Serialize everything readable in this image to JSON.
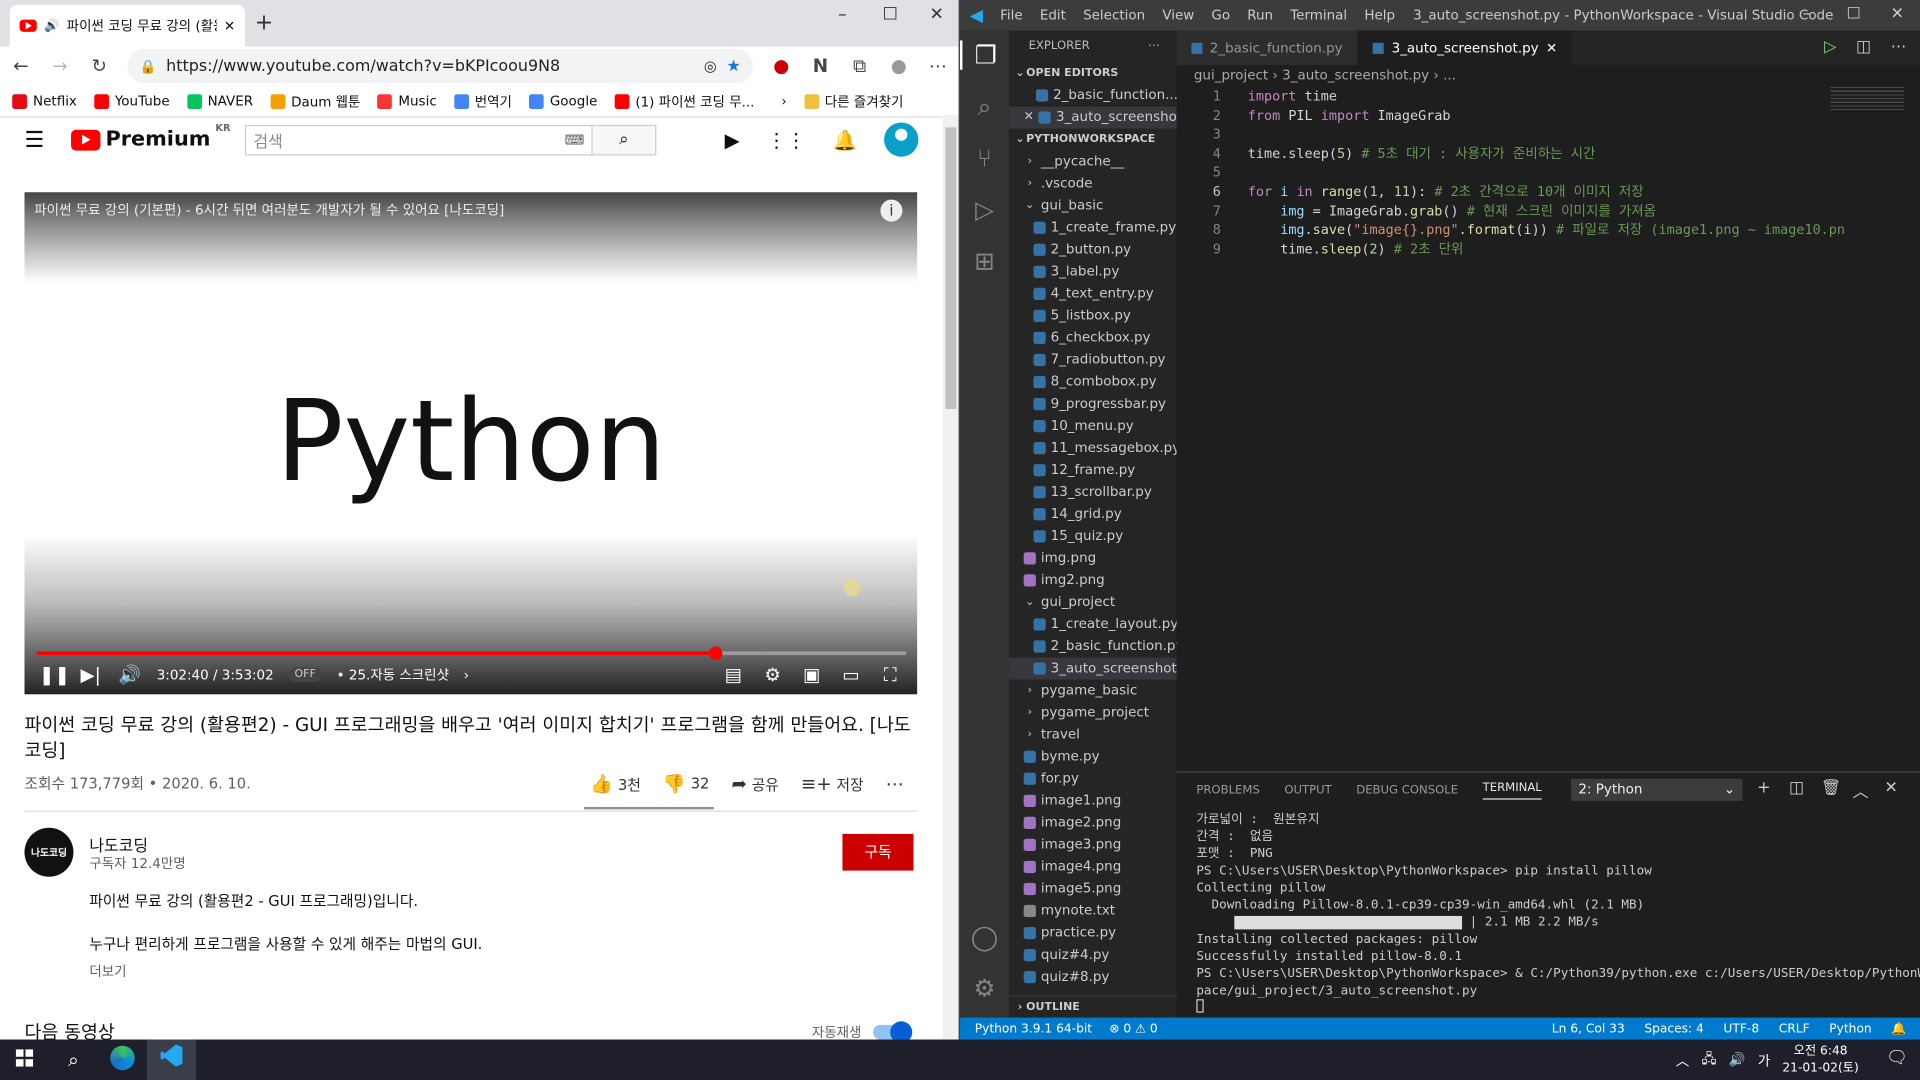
{
  "browser": {
    "tab_title": "파이썬 코딩 무료 강의 (활용",
    "url": "https://www.youtube.com/watch?v=bKPIcoou9N8",
    "bookmarks": [
      {
        "label": "Netflix",
        "color": "#e50914"
      },
      {
        "label": "YouTube",
        "color": "#ff0000"
      },
      {
        "label": "NAVER",
        "color": "#03c75a"
      },
      {
        "label": "Daum 웹툰",
        "color": "#f4a100"
      },
      {
        "label": "Music",
        "color": "#ff3333"
      },
      {
        "label": "번역기",
        "color": "#4285f4"
      },
      {
        "label": "Google",
        "color": "#4285f4"
      },
      {
        "label": "(1) 파이썬 코딩 무...",
        "color": "#ff0000"
      }
    ],
    "other_bookmarks": "다른 즐겨찾기"
  },
  "youtube": {
    "logo": "Premium",
    "region": "KR",
    "search_placeholder": "검색",
    "player_title": "파이썬 무료 강의 (기본편) - 6시간 뒤면 여러분도 개발자가 될 수 있어요 [나도코딩]",
    "player_word": "Python",
    "time": "3:02:40 / 3:53:02",
    "progress": 0.78,
    "autoplay_off": "OFF",
    "chapter": "• 25.자동 스크린샷",
    "video_title": "파이썬 코딩 무료 강의 (활용편2) - GUI 프로그래밍을 배우고 '여러 이미지 합치기' 프로그램을 함께 만들어요. [나도코딩]",
    "meta": "조회수 173,779회 • 2020. 6. 10.",
    "likes": "3천",
    "dislikes": "32",
    "share": "공유",
    "save": "저장",
    "channel": "나도코딩",
    "channel_avatar": "나도코딩",
    "subscribers": "구독자 12.4만명",
    "subscribe": "구독",
    "desc1": "파이썬 무료 강의 (활용편2 - GUI 프로그래밍)입니다.",
    "desc2": "누구나 편리하게 프로그램을 사용할 수 있게 해주는 마법의 GUI.",
    "more": "더보기",
    "next": "다음 동영상",
    "autoplay": "자동재생"
  },
  "vscode": {
    "menu": [
      "File",
      "Edit",
      "Selection",
      "View",
      "Go",
      "Run",
      "Terminal",
      "Help"
    ],
    "title": "3_auto_screenshot.py - PythonWorkspace - Visual Studio Code",
    "explorer": "EXPLORER",
    "open_editors": "OPEN EDITORS",
    "open_files": [
      "2_basic_function....",
      "3_auto_screensho..."
    ],
    "workspace": "PYTHONWORKSPACE",
    "tree": [
      {
        "label": "__pycache__",
        "t": "dir",
        "d": 1
      },
      {
        "label": ".vscode",
        "t": "dir",
        "d": 1
      },
      {
        "label": "gui_basic",
        "t": "open",
        "d": 1
      },
      {
        "label": "1_create_frame.py",
        "t": "py",
        "d": 2
      },
      {
        "label": "2_button.py",
        "t": "py",
        "d": 2
      },
      {
        "label": "3_label.py",
        "t": "py",
        "d": 2
      },
      {
        "label": "4_text_entry.py",
        "t": "py",
        "d": 2
      },
      {
        "label": "5_listbox.py",
        "t": "py",
        "d": 2
      },
      {
        "label": "6_checkbox.py",
        "t": "py",
        "d": 2
      },
      {
        "label": "7_radiobutton.py",
        "t": "py",
        "d": 2
      },
      {
        "label": "8_combobox.py",
        "t": "py",
        "d": 2
      },
      {
        "label": "9_progressbar.py",
        "t": "py",
        "d": 2
      },
      {
        "label": "10_menu.py",
        "t": "py",
        "d": 2
      },
      {
        "label": "11_messagebox.py",
        "t": "py",
        "d": 2
      },
      {
        "label": "12_frame.py",
        "t": "py",
        "d": 2
      },
      {
        "label": "13_scrollbar.py",
        "t": "py",
        "d": 2
      },
      {
        "label": "14_grid.py",
        "t": "py",
        "d": 2
      },
      {
        "label": "15_quiz.py",
        "t": "py",
        "d": 2
      },
      {
        "label": "img.png",
        "t": "png",
        "d": 1
      },
      {
        "label": "img2.png",
        "t": "png",
        "d": 1
      },
      {
        "label": "gui_project",
        "t": "open",
        "d": 1
      },
      {
        "label": "1_create_layout.py",
        "t": "py",
        "d": 2
      },
      {
        "label": "2_basic_function.py",
        "t": "py",
        "d": 2
      },
      {
        "label": "3_auto_screenshot.py",
        "t": "py",
        "d": 2,
        "sel": true
      },
      {
        "label": "pygame_basic",
        "t": "dir",
        "d": 1
      },
      {
        "label": "pygame_project",
        "t": "dir",
        "d": 1
      },
      {
        "label": "travel",
        "t": "dir",
        "d": 1
      },
      {
        "label": "byme.py",
        "t": "py",
        "d": 1
      },
      {
        "label": "for.py",
        "t": "py",
        "d": 1
      },
      {
        "label": "image1.png",
        "t": "png",
        "d": 1
      },
      {
        "label": "image2.png",
        "t": "png",
        "d": 1
      },
      {
        "label": "image3.png",
        "t": "png",
        "d": 1
      },
      {
        "label": "image4.png",
        "t": "png",
        "d": 1
      },
      {
        "label": "image5.png",
        "t": "png",
        "d": 1
      },
      {
        "label": "mynote.txt",
        "t": "txt",
        "d": 1
      },
      {
        "label": "practice.py",
        "t": "py",
        "d": 1
      },
      {
        "label": "quiz#4.py",
        "t": "py",
        "d": 1
      },
      {
        "label": "quiz#8.py",
        "t": "py",
        "d": 1
      }
    ],
    "outline": "OUTLINE",
    "tabs": [
      "2_basic_function.py",
      "3_auto_screenshot.py"
    ],
    "breadcrumb": "gui_project  ›  3_auto_screenshot.py  ›  ...",
    "code": [
      [
        [
          "kw",
          "import "
        ],
        [
          "pl",
          "time"
        ]
      ],
      [
        [
          "kw",
          "from "
        ],
        [
          "pl",
          "PIL "
        ],
        [
          "kw",
          "import "
        ],
        [
          "pl",
          "ImageGrab"
        ]
      ],
      [],
      [
        [
          "pl",
          "time.sleep("
        ],
        [
          "nm",
          "5"
        ],
        [
          "pl",
          ") "
        ],
        [
          "cm",
          "# 5초 대기 : 사용자가 준비하는 시간"
        ]
      ],
      [],
      [
        [
          "kw",
          "for "
        ],
        [
          "vr",
          "i "
        ],
        [
          "kw",
          "in "
        ],
        [
          "fn",
          "range"
        ],
        [
          "pl",
          "("
        ],
        [
          "nm",
          "1"
        ],
        [
          "pl",
          ", "
        ],
        [
          "nm",
          "11"
        ],
        [
          "pl",
          "): "
        ],
        [
          "cm",
          "# 2초 간격으로 10개 이미지 저장"
        ]
      ],
      [
        [
          "pl",
          "    "
        ],
        [
          "vr",
          "img"
        ],
        [
          "pl",
          " = ImageGrab."
        ],
        [
          "fn",
          "grab"
        ],
        [
          "pl",
          "() "
        ],
        [
          "cm",
          "# 현재 스크린 이미지를 가져옴"
        ]
      ],
      [
        [
          "pl",
          "    "
        ],
        [
          "vr",
          "img"
        ],
        [
          "pl",
          "."
        ],
        [
          "fn",
          "save"
        ],
        [
          "pl",
          "("
        ],
        [
          "st",
          "\"image{}.png\""
        ],
        [
          "pl",
          "."
        ],
        [
          "fn",
          "format"
        ],
        [
          "pl",
          "(i)) "
        ],
        [
          "cm",
          "# 파일로 저장 (image1.png ~ image10.pn"
        ]
      ],
      [
        [
          "pl",
          "    time."
        ],
        [
          "fn",
          "sleep"
        ],
        [
          "pl",
          "("
        ],
        [
          "nm",
          "2"
        ],
        [
          "pl",
          ") "
        ],
        [
          "cm",
          "# 2초 단위"
        ]
      ]
    ],
    "panel_tabs": [
      "PROBLEMS",
      "OUTPUT",
      "DEBUG CONSOLE",
      "TERMINAL"
    ],
    "terminal_select": "2: Python",
    "terminal": [
      "가로넓이 :  원본유지",
      "간격 :  없음",
      "포맷 :  PNG",
      "PS C:\\Users\\USER\\Desktop\\PythonWorkspace> pip install pillow",
      "Collecting pillow",
      "  Downloading Pillow-8.0.1-cp39-cp39-win_amd64.whl (2.1 MB)",
      "     |                                 | 2.1 MB 2.2 MB/s",
      "Installing collected packages: pillow",
      "Successfully installed pillow-8.0.1",
      "PS C:\\Users\\USER\\Desktop\\PythonWorkspace> & C:/Python39/python.exe c:/Users/USER/Desktop/PythonWorks",
      "pace/gui_project/3_auto_screenshot.py"
    ],
    "status_left": [
      "Python 3.9.1 64-bit",
      "⊗ 0 ⚠ 0"
    ],
    "status_right": [
      "Ln 6, Col 33",
      "Spaces: 4",
      "UTF-8",
      "CRLF",
      "Python"
    ]
  },
  "taskbar": {
    "time": "오전 6:48",
    "date": "21-01-02(토)",
    "ime": "가",
    "notifications": "1"
  }
}
